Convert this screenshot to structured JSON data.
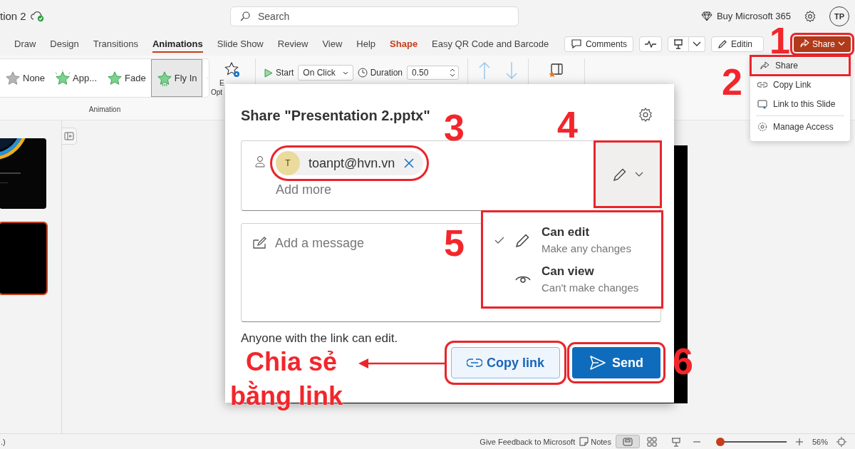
{
  "title_bar": {
    "doc_name": "tion 2",
    "search": {
      "placeholder": "Search"
    },
    "buy": "Buy Microsoft 365",
    "avatar": "TP"
  },
  "tabs": [
    {
      "label": "Draw",
      "selected": false,
      "kind": "normal"
    },
    {
      "label": "Design",
      "selected": false,
      "kind": "normal"
    },
    {
      "label": "Transitions",
      "selected": false,
      "kind": "normal"
    },
    {
      "label": "Animations",
      "selected": true,
      "kind": "normal"
    },
    {
      "label": "Slide Show",
      "selected": false,
      "kind": "normal"
    },
    {
      "label": "Review",
      "selected": false,
      "kind": "normal"
    },
    {
      "label": "View",
      "selected": false,
      "kind": "normal"
    },
    {
      "label": "Help",
      "selected": false,
      "kind": "normal"
    },
    {
      "label": "Shape",
      "selected": false,
      "kind": "contextual"
    },
    {
      "label": "Easy QR Code and Barcode",
      "selected": false,
      "kind": "normal"
    }
  ],
  "toolbar": {
    "comments": "Comments",
    "editing": "Editin",
    "share": "Share"
  },
  "ribbon": {
    "animations": [
      {
        "label": "None",
        "selected": false,
        "kind": "none"
      },
      {
        "label": "App...",
        "selected": false,
        "kind": "appear"
      },
      {
        "label": "Fade",
        "selected": false,
        "kind": "fade"
      },
      {
        "label": "Fly In",
        "selected": true,
        "kind": "fly"
      }
    ],
    "group_label": "Animation",
    "effect_options": [
      "E",
      "Opt"
    ],
    "timing": {
      "start_label": "Start",
      "start_value": "On Click",
      "duration_label": "Duration",
      "duration_value": "0.50"
    }
  },
  "share_menu": [
    {
      "label": "Share",
      "selected": true,
      "kind": "share"
    },
    {
      "label": "Copy Link",
      "selected": false,
      "kind": "link"
    },
    {
      "label": "Link to this Slide",
      "selected": false,
      "kind": "slide"
    },
    {
      "label": "Manage Access",
      "selected": false,
      "kind": "gear"
    }
  ],
  "slides": [
    {
      "selected": false,
      "kind": "picture"
    },
    {
      "selected": true,
      "kind": "blank"
    }
  ],
  "dialog": {
    "title": "Share \"Presentation 2.pptx\"",
    "recipients": [
      {
        "initial": "T",
        "email": "toanpt@hvn.vn"
      }
    ],
    "add_more": "Add more",
    "message_placeholder": "Add a message",
    "permissions": [
      {
        "label": "Can edit",
        "description": "Make any changes",
        "selected": true,
        "kind": "edit"
      },
      {
        "label": "Can view",
        "description": "Can't make changes",
        "selected": false,
        "kind": "view"
      }
    ],
    "link_note": "Anyone with the link can edit.",
    "copy_link": "Copy link",
    "send": "Send"
  },
  "status_bar": {
    "left": ".)",
    "feedback": "Give Feedback to Microsoft",
    "notes": "Notes",
    "views": [
      {
        "kind": "normal",
        "selected": true
      },
      {
        "kind": "sorter",
        "selected": false
      },
      {
        "kind": "reading",
        "selected": false
      }
    ],
    "zoom": {
      "level": 0.05,
      "reading": "56%"
    }
  },
  "annotations": {
    "steps": [
      "1",
      "2",
      "3",
      "4",
      "5",
      "6"
    ],
    "caption": [
      "Chia sẻ",
      "bằng link"
    ]
  }
}
